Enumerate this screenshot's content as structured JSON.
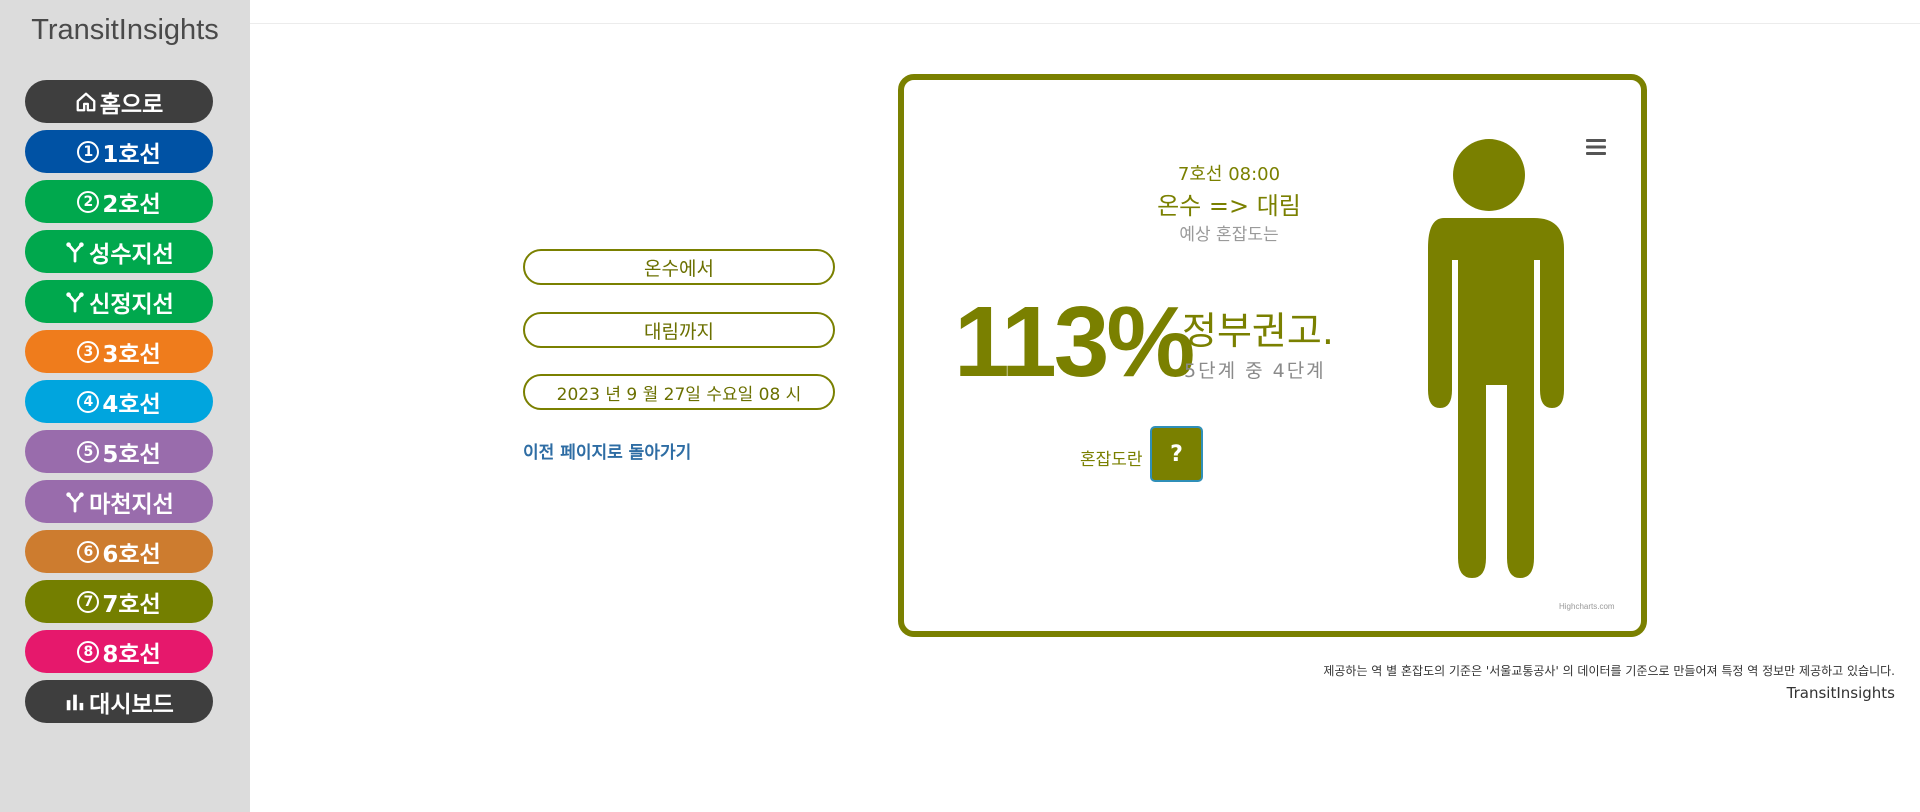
{
  "brand": "TransitInsights",
  "nav": {
    "items": [
      {
        "icon": "home-icon",
        "label": "홈으로",
        "color": "#3e3e3e"
      },
      {
        "icon": "line-1-icon",
        "num": "1",
        "label": "1호선",
        "color": "#0052a4"
      },
      {
        "icon": "line-2-icon",
        "num": "2",
        "label": "2호선",
        "color": "#00a84d"
      },
      {
        "icon": "branch-icon",
        "label": "성수지선",
        "color": "#00a84d"
      },
      {
        "icon": "branch-icon",
        "label": "신정지선",
        "color": "#00a84d"
      },
      {
        "icon": "line-3-icon",
        "num": "3",
        "label": "3호선",
        "color": "#ef7c1c"
      },
      {
        "icon": "line-4-icon",
        "num": "4",
        "label": "4호선",
        "color": "#00a5de"
      },
      {
        "icon": "line-5-icon",
        "num": "5",
        "label": "5호선",
        "color": "#996cac"
      },
      {
        "icon": "branch-icon",
        "label": "마천지선",
        "color": "#996cac"
      },
      {
        "icon": "line-6-icon",
        "num": "6",
        "label": "6호선",
        "color": "#cd7c2f"
      },
      {
        "icon": "line-7-icon",
        "num": "7",
        "label": "7호선",
        "color": "#747f00"
      },
      {
        "icon": "line-8-icon",
        "num": "8",
        "label": "8호선",
        "color": "#e6186c"
      },
      {
        "icon": "bar-chart-icon",
        "label": "대시보드",
        "color": "#3e3e3e"
      }
    ]
  },
  "form": {
    "from": "온수에서",
    "to": "대림까지",
    "datetime": "2023 년 9 월 27일 수요일 08 시",
    "back": "이전 페이지로 돌아가기"
  },
  "result": {
    "time": "7호선 08:00",
    "route": "온수 => 대림",
    "prediction_label": "예상 혼잡도는",
    "percent": "113%",
    "advice": "정부권고.",
    "level": "5단계 중 4단계",
    "help_label": "혼잡도란",
    "help_button": "?",
    "credit": "Highcharts.com"
  },
  "footer": {
    "note": "제공하는 역 별 혼잡도의 기준은 '서울교통공사' 의 데이터를 기준으로 만들어져 특정 역 정보만 제공하고 있습니다.",
    "brand": "TransitInsights"
  },
  "colors": {
    "accent": "#7a8000",
    "link": "#2e6da4"
  }
}
